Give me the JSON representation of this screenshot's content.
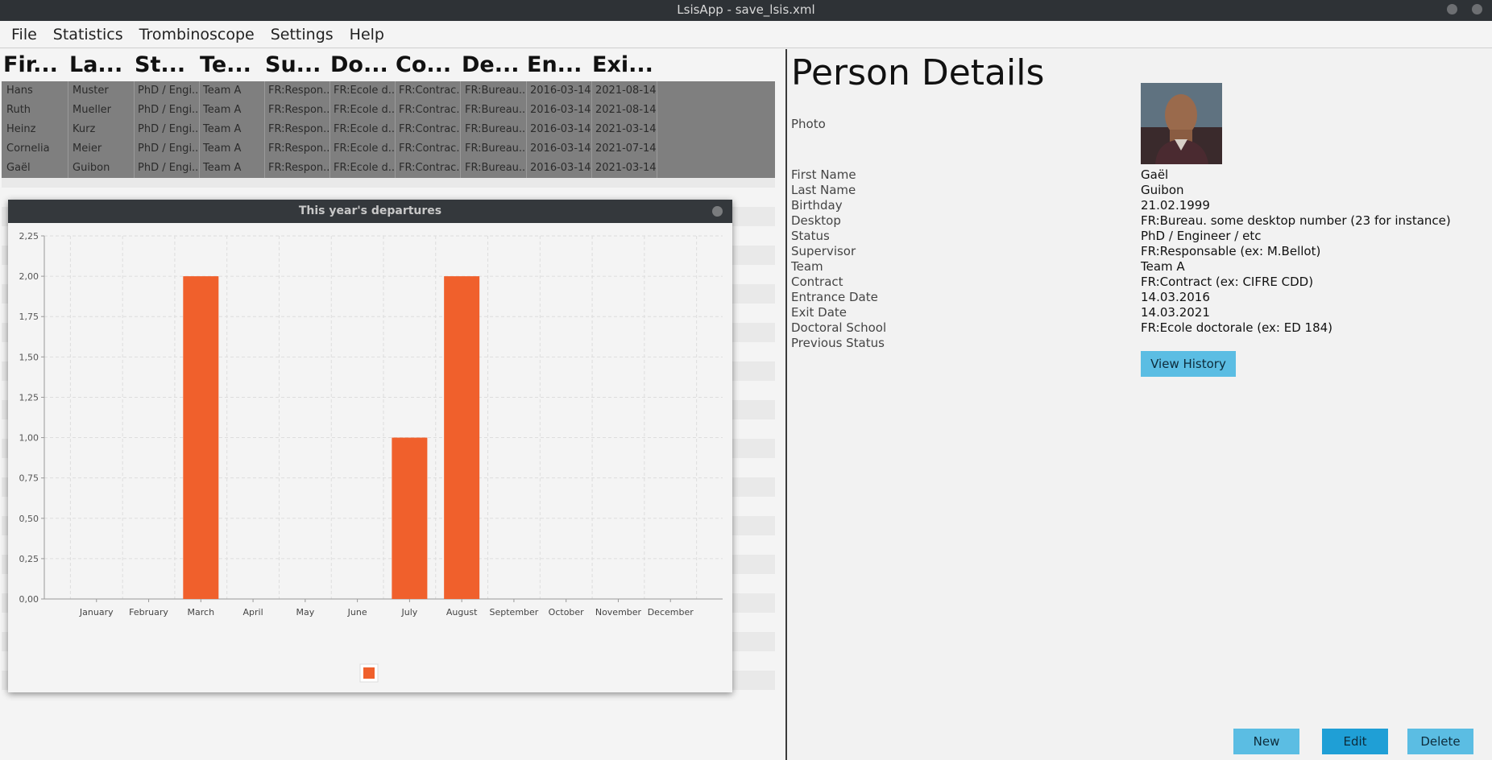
{
  "window": {
    "title": "LsisApp - save_lsis.xml"
  },
  "menubar": {
    "items": [
      "File",
      "Statistics",
      "Trombinoscope",
      "Settings",
      "Help"
    ]
  },
  "table": {
    "columns": [
      "Fir...",
      "La...",
      "St...",
      "Te...",
      "Su...",
      "Do...",
      "Co...",
      "De...",
      "En...",
      "Exi..."
    ],
    "rows": [
      [
        "Hans",
        "Muster",
        "PhD / Engi...",
        "Team A",
        "FR:Respon...",
        "FR:Ecole d...",
        "FR:Contrac...",
        "FR:Bureau....",
        "2016-03-14",
        "2021-08-14"
      ],
      [
        "Ruth",
        "Mueller",
        "PhD / Engi...",
        "Team A",
        "FR:Respon...",
        "FR:Ecole d...",
        "FR:Contrac...",
        "FR:Bureau....",
        "2016-03-14",
        "2021-08-14"
      ],
      [
        "Heinz",
        "Kurz",
        "PhD / Engi...",
        "Team A",
        "FR:Respon...",
        "FR:Ecole d...",
        "FR:Contrac...",
        "FR:Bureau....",
        "2016-03-14",
        "2021-03-14"
      ],
      [
        "Cornelia",
        "Meier",
        "PhD / Engi...",
        "Team A",
        "FR:Respon...",
        "FR:Ecole d...",
        "FR:Contrac...",
        "FR:Bureau....",
        "2016-03-14",
        "2021-07-14"
      ],
      [
        "Gaël",
        "Guibon",
        "PhD / Engi...",
        "Team A",
        "FR:Respon...",
        "FR:Ecole d...",
        "FR:Contrac...",
        "FR:Bureau....",
        "2016-03-14",
        "2021-03-14"
      ]
    ]
  },
  "chart_window": {
    "title": "This year's departures"
  },
  "chart_data": {
    "type": "bar",
    "title": "",
    "xlabel": "",
    "ylabel": "",
    "categories": [
      "January",
      "February",
      "March",
      "April",
      "May",
      "June",
      "July",
      "August",
      "September",
      "October",
      "November",
      "December"
    ],
    "values": [
      0,
      0,
      2,
      0,
      0,
      0,
      1,
      2,
      0,
      0,
      0,
      0
    ],
    "ylim": [
      0,
      2.25
    ],
    "yticks": [
      "0,00",
      "0,25",
      "0,50",
      "0,75",
      "1,00",
      "1,25",
      "1,50",
      "1,75",
      "2,00",
      "2,25"
    ],
    "grid": true,
    "legend": "bottom-center",
    "bar_color": "#f0602c"
  },
  "details": {
    "title": "Person Details",
    "photo_label": "Photo",
    "fields": [
      {
        "label": "First Name",
        "value": "Gaël"
      },
      {
        "label": "Last Name",
        "value": "Guibon"
      },
      {
        "label": "Birthday",
        "value": "21.02.1999"
      },
      {
        "label": "Desktop",
        "value": "FR:Bureau. some desktop number (23 for instance)"
      },
      {
        "label": "Status",
        "value": "PhD / Engineer / etc"
      },
      {
        "label": "Supervisor",
        "value": "FR:Responsable (ex: M.Bellot)"
      },
      {
        "label": "Team",
        "value": "Team A"
      },
      {
        "label": "Contract",
        "value": "FR:Contract (ex: CIFRE CDD)"
      },
      {
        "label": "Entrance Date",
        "value": "14.03.2016"
      },
      {
        "label": "Exit Date",
        "value": "14.03.2021"
      },
      {
        "label": "Doctoral School",
        "value": "FR:Ecole doctorale (ex: ED 184)"
      },
      {
        "label": "Previous Status",
        "value": ""
      }
    ],
    "view_history_label": "View History"
  },
  "actions": {
    "new_label": "New",
    "edit_label": "Edit",
    "delete_label": "Delete"
  },
  "colors": {
    "accent_button": "#5bbde3",
    "accent_button_active": "#1f9fd6",
    "bar": "#f0602c"
  }
}
